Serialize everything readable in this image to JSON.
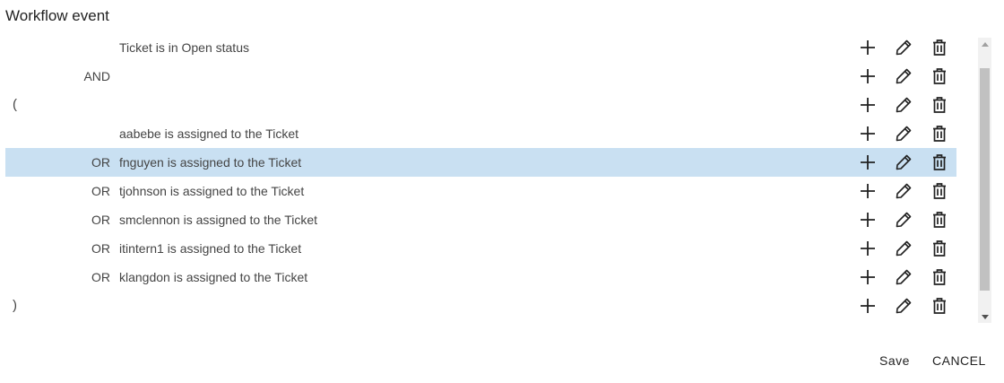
{
  "dialog": {
    "title": "Workflow event"
  },
  "rows": [
    {
      "paren": "",
      "op": "",
      "desc": "Ticket is in Open status",
      "selected": false
    },
    {
      "paren": "",
      "op": "AND",
      "desc": "",
      "selected": false
    },
    {
      "paren": "(",
      "op": "",
      "desc": "",
      "selected": false
    },
    {
      "paren": "",
      "op": "",
      "desc": "aabebe is assigned to the Ticket",
      "selected": false
    },
    {
      "paren": "",
      "op": "OR",
      "desc": "fnguyen is assigned to the Ticket",
      "selected": true
    },
    {
      "paren": "",
      "op": "OR",
      "desc": "tjohnson is assigned to the Ticket",
      "selected": false
    },
    {
      "paren": "",
      "op": "OR",
      "desc": "smclennon is assigned to the Ticket",
      "selected": false
    },
    {
      "paren": "",
      "op": "OR",
      "desc": "itintern1 is assigned to the Ticket",
      "selected": false
    },
    {
      "paren": "",
      "op": "OR",
      "desc": "klangdon is assigned to the Ticket",
      "selected": false
    },
    {
      "paren": ")",
      "op": "",
      "desc": "",
      "selected": false
    }
  ],
  "icons": {
    "add": "plus-icon",
    "edit": "pencil-icon",
    "delete": "trash-icon"
  },
  "colors": {
    "selected_row": "#c9e0f2",
    "icon": "#222222"
  },
  "footer": {
    "save_label": "Save",
    "cancel_label": "CANCEL"
  }
}
